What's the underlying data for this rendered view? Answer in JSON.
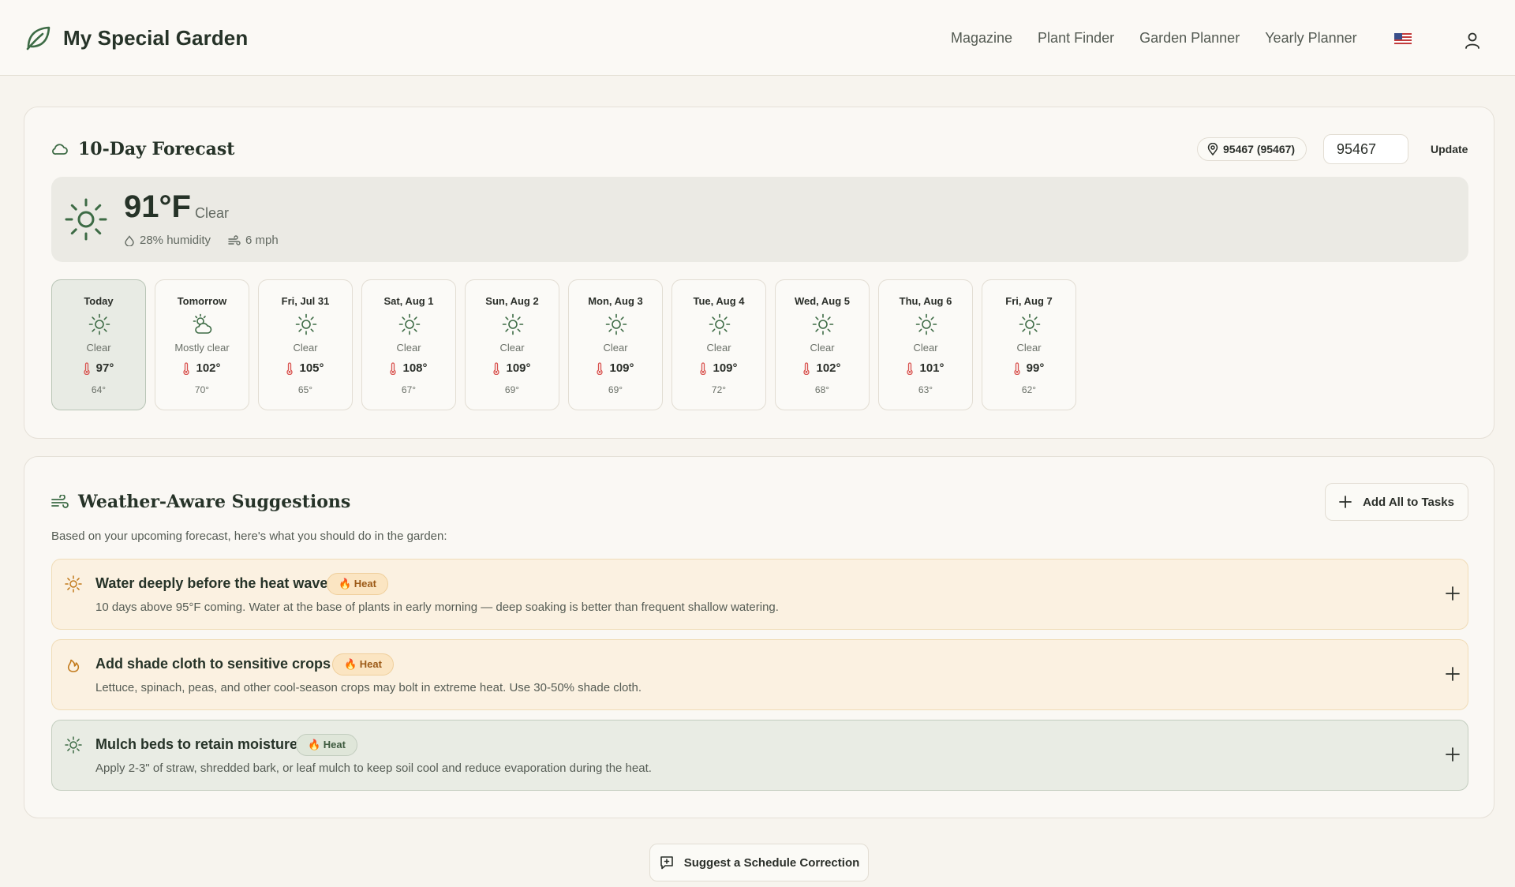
{
  "app": {
    "brand": "My Special Garden",
    "nav": [
      "Magazine",
      "Plant Finder",
      "Garden Planner",
      "Yearly Planner"
    ]
  },
  "colors": {
    "brand_green": "#3d6b45",
    "heat_badge": "#fbe5c2",
    "thermometer": "#d9534f"
  },
  "forecast": {
    "title": "10-Day Forecast",
    "location": "95467 (95467)",
    "zip_value": "95467",
    "update_label": "Update",
    "current": {
      "temp": "91°F",
      "condition": "Clear",
      "humidity": "28% humidity",
      "wind": "6 mph"
    },
    "days": [
      {
        "name": "Today",
        "icon": "sun-icon",
        "cond": "Clear",
        "hi": "97°",
        "lo": "64°"
      },
      {
        "name": "Tomorrow",
        "icon": "partly-cloudy-icon",
        "cond": "Mostly clear",
        "hi": "102°",
        "lo": "70°"
      },
      {
        "name": "Fri, Jul 31",
        "icon": "sun-icon",
        "cond": "Clear",
        "hi": "105°",
        "lo": "65°"
      },
      {
        "name": "Sat, Aug 1",
        "icon": "sun-icon",
        "cond": "Clear",
        "hi": "108°",
        "lo": "67°"
      },
      {
        "name": "Sun, Aug 2",
        "icon": "sun-icon",
        "cond": "Clear",
        "hi": "109°",
        "lo": "69°"
      },
      {
        "name": "Mon, Aug 3",
        "icon": "sun-icon",
        "cond": "Clear",
        "hi": "109°",
        "lo": "69°"
      },
      {
        "name": "Tue, Aug 4",
        "icon": "sun-icon",
        "cond": "Clear",
        "hi": "109°",
        "lo": "72°"
      },
      {
        "name": "Wed, Aug 5",
        "icon": "sun-icon",
        "cond": "Clear",
        "hi": "102°",
        "lo": "68°"
      },
      {
        "name": "Thu, Aug 6",
        "icon": "sun-icon",
        "cond": "Clear",
        "hi": "101°",
        "lo": "63°"
      },
      {
        "name": "Fri, Aug 7",
        "icon": "sun-icon",
        "cond": "Clear",
        "hi": "99°",
        "lo": "62°"
      }
    ]
  },
  "suggestions": {
    "title": "Weather-Aware Suggestions",
    "add_all_label": "Add All to Tasks",
    "intro": "Based on your upcoming forecast, here's what you should do in the garden:",
    "items": [
      {
        "title": "Water deeply before the heat wave",
        "badge": "🔥 Heat",
        "icon": "sun-icon",
        "desc": "10 days above 95°F coming. Water at the base of plants in early morning — deep soaking is better than frequent shallow watering."
      },
      {
        "title": "Add shade cloth to sensitive crops",
        "badge": "🔥 Heat",
        "icon": "flame-icon",
        "desc": "Lettuce, spinach, peas, and other cool-season crops may bolt in extreme heat. Use 30-50% shade cloth."
      },
      {
        "title": "Mulch beds to retain moisture",
        "badge": "🔥 Heat",
        "icon": "sun-icon",
        "desc": "Apply 2-3\" of straw, shredded bark, or leaf mulch to keep soil cool and reduce evaporation during the heat."
      }
    ]
  },
  "footer": {
    "correction_label": "Suggest a Schedule Correction"
  }
}
